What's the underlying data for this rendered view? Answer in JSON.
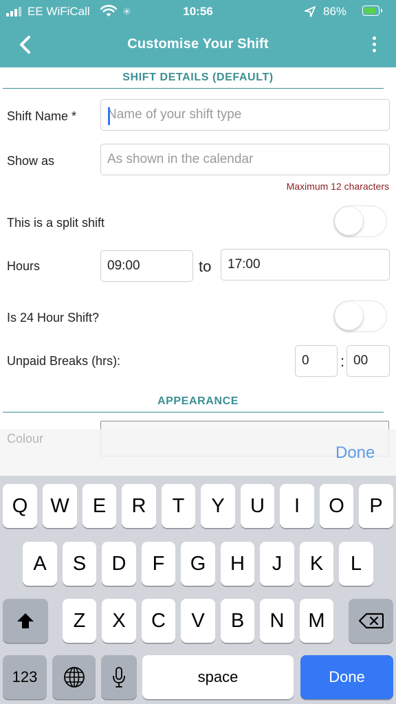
{
  "status_bar": {
    "carrier": "EE WiFiCall",
    "time": "10:56",
    "battery_percent": "86%",
    "battery_level": 0.86,
    "icons": [
      "signal-icon",
      "wifi-icon",
      "activity-spinner-icon",
      "location-arrow-icon",
      "battery-icon"
    ]
  },
  "header": {
    "title": "Customise Your Shift",
    "back_icon": "chevron-left-icon",
    "menu_icon": "more-vertical-icon"
  },
  "shift_details": {
    "section_title": "SHIFT DETAILS (DEFAULT)",
    "shift_name": {
      "label": "Shift Name *",
      "placeholder": "Name of your shift type",
      "value": ""
    },
    "show_as": {
      "label": "Show as",
      "placeholder": "As shown in the calendar",
      "value": "",
      "hint": "Maximum 12 characters"
    },
    "split_shift": {
      "label": "This is a split shift",
      "on": false
    },
    "hours": {
      "label": "Hours",
      "start": "09:00",
      "separator": "to",
      "end": "17:00"
    },
    "hour24": {
      "label": "Is 24 Hour Shift?",
      "on": false
    },
    "breaks": {
      "label": "Unpaid Breaks (hrs):",
      "hours": "0",
      "separator": ":",
      "minutes": "00"
    }
  },
  "appearance": {
    "section_title": "APPEARANCE",
    "colour_label": "Colour"
  },
  "keyboard": {
    "accessory_done": "Done",
    "row1": [
      "Q",
      "W",
      "E",
      "R",
      "T",
      "Y",
      "U",
      "I",
      "O",
      "P"
    ],
    "row2": [
      "A",
      "S",
      "D",
      "F",
      "G",
      "H",
      "J",
      "K",
      "L"
    ],
    "row3": [
      "Z",
      "X",
      "C",
      "V",
      "B",
      "N",
      "M"
    ],
    "numbers_key": "123",
    "space_key": "space",
    "done_key": "Done",
    "colors": {
      "accent": "#3478f6",
      "header": "#56b1b7",
      "section": "#3b8f94"
    }
  }
}
